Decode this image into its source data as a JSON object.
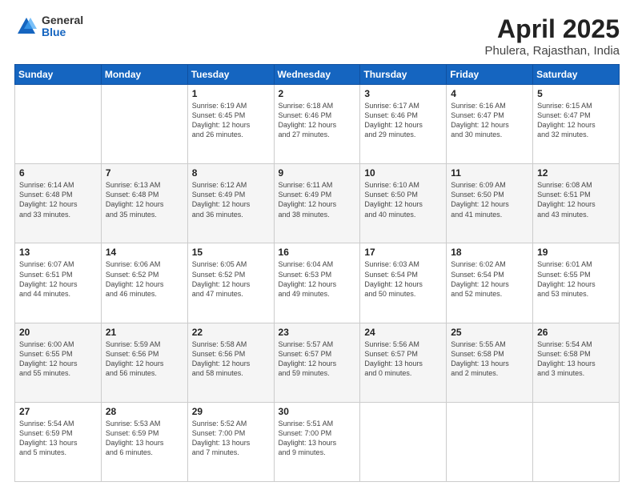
{
  "logo": {
    "general": "General",
    "blue": "Blue"
  },
  "header": {
    "title": "April 2025",
    "subtitle": "Phulera, Rajasthan, India"
  },
  "days_of_week": [
    "Sunday",
    "Monday",
    "Tuesday",
    "Wednesday",
    "Thursday",
    "Friday",
    "Saturday"
  ],
  "weeks": [
    [
      {
        "day": "",
        "info": ""
      },
      {
        "day": "",
        "info": ""
      },
      {
        "day": "1",
        "info": "Sunrise: 6:19 AM\nSunset: 6:45 PM\nDaylight: 12 hours\nand 26 minutes."
      },
      {
        "day": "2",
        "info": "Sunrise: 6:18 AM\nSunset: 6:46 PM\nDaylight: 12 hours\nand 27 minutes."
      },
      {
        "day": "3",
        "info": "Sunrise: 6:17 AM\nSunset: 6:46 PM\nDaylight: 12 hours\nand 29 minutes."
      },
      {
        "day": "4",
        "info": "Sunrise: 6:16 AM\nSunset: 6:47 PM\nDaylight: 12 hours\nand 30 minutes."
      },
      {
        "day": "5",
        "info": "Sunrise: 6:15 AM\nSunset: 6:47 PM\nDaylight: 12 hours\nand 32 minutes."
      }
    ],
    [
      {
        "day": "6",
        "info": "Sunrise: 6:14 AM\nSunset: 6:48 PM\nDaylight: 12 hours\nand 33 minutes."
      },
      {
        "day": "7",
        "info": "Sunrise: 6:13 AM\nSunset: 6:48 PM\nDaylight: 12 hours\nand 35 minutes."
      },
      {
        "day": "8",
        "info": "Sunrise: 6:12 AM\nSunset: 6:49 PM\nDaylight: 12 hours\nand 36 minutes."
      },
      {
        "day": "9",
        "info": "Sunrise: 6:11 AM\nSunset: 6:49 PM\nDaylight: 12 hours\nand 38 minutes."
      },
      {
        "day": "10",
        "info": "Sunrise: 6:10 AM\nSunset: 6:50 PM\nDaylight: 12 hours\nand 40 minutes."
      },
      {
        "day": "11",
        "info": "Sunrise: 6:09 AM\nSunset: 6:50 PM\nDaylight: 12 hours\nand 41 minutes."
      },
      {
        "day": "12",
        "info": "Sunrise: 6:08 AM\nSunset: 6:51 PM\nDaylight: 12 hours\nand 43 minutes."
      }
    ],
    [
      {
        "day": "13",
        "info": "Sunrise: 6:07 AM\nSunset: 6:51 PM\nDaylight: 12 hours\nand 44 minutes."
      },
      {
        "day": "14",
        "info": "Sunrise: 6:06 AM\nSunset: 6:52 PM\nDaylight: 12 hours\nand 46 minutes."
      },
      {
        "day": "15",
        "info": "Sunrise: 6:05 AM\nSunset: 6:52 PM\nDaylight: 12 hours\nand 47 minutes."
      },
      {
        "day": "16",
        "info": "Sunrise: 6:04 AM\nSunset: 6:53 PM\nDaylight: 12 hours\nand 49 minutes."
      },
      {
        "day": "17",
        "info": "Sunrise: 6:03 AM\nSunset: 6:54 PM\nDaylight: 12 hours\nand 50 minutes."
      },
      {
        "day": "18",
        "info": "Sunrise: 6:02 AM\nSunset: 6:54 PM\nDaylight: 12 hours\nand 52 minutes."
      },
      {
        "day": "19",
        "info": "Sunrise: 6:01 AM\nSunset: 6:55 PM\nDaylight: 12 hours\nand 53 minutes."
      }
    ],
    [
      {
        "day": "20",
        "info": "Sunrise: 6:00 AM\nSunset: 6:55 PM\nDaylight: 12 hours\nand 55 minutes."
      },
      {
        "day": "21",
        "info": "Sunrise: 5:59 AM\nSunset: 6:56 PM\nDaylight: 12 hours\nand 56 minutes."
      },
      {
        "day": "22",
        "info": "Sunrise: 5:58 AM\nSunset: 6:56 PM\nDaylight: 12 hours\nand 58 minutes."
      },
      {
        "day": "23",
        "info": "Sunrise: 5:57 AM\nSunset: 6:57 PM\nDaylight: 12 hours\nand 59 minutes."
      },
      {
        "day": "24",
        "info": "Sunrise: 5:56 AM\nSunset: 6:57 PM\nDaylight: 13 hours\nand 0 minutes."
      },
      {
        "day": "25",
        "info": "Sunrise: 5:55 AM\nSunset: 6:58 PM\nDaylight: 13 hours\nand 2 minutes."
      },
      {
        "day": "26",
        "info": "Sunrise: 5:54 AM\nSunset: 6:58 PM\nDaylight: 13 hours\nand 3 minutes."
      }
    ],
    [
      {
        "day": "27",
        "info": "Sunrise: 5:54 AM\nSunset: 6:59 PM\nDaylight: 13 hours\nand 5 minutes."
      },
      {
        "day": "28",
        "info": "Sunrise: 5:53 AM\nSunset: 6:59 PM\nDaylight: 13 hours\nand 6 minutes."
      },
      {
        "day": "29",
        "info": "Sunrise: 5:52 AM\nSunset: 7:00 PM\nDaylight: 13 hours\nand 7 minutes."
      },
      {
        "day": "30",
        "info": "Sunrise: 5:51 AM\nSunset: 7:00 PM\nDaylight: 13 hours\nand 9 minutes."
      },
      {
        "day": "",
        "info": ""
      },
      {
        "day": "",
        "info": ""
      },
      {
        "day": "",
        "info": ""
      }
    ]
  ]
}
